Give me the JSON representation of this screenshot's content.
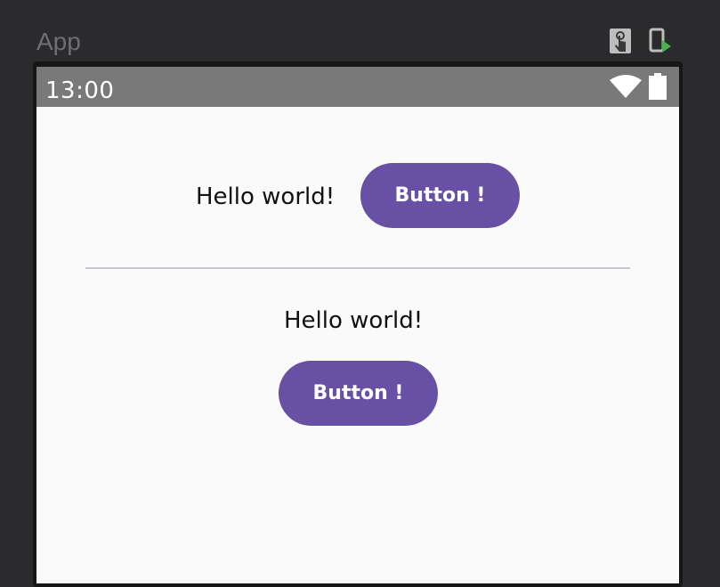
{
  "preview": {
    "title": "App",
    "touch_icon": "touch-mode-icon",
    "deploy_icon": "deploy-to-device-icon",
    "deploy_color": "#4caf50"
  },
  "status_bar": {
    "time": "13:00",
    "background": "#797979",
    "icons": [
      "wifi-icon",
      "battery-icon"
    ]
  },
  "content": {
    "row": {
      "text": "Hello world!",
      "button_label": "Button !"
    },
    "column": {
      "text": "Hello world!",
      "button_label": "Button !"
    },
    "accent_color": "#6850a4",
    "divider_color": "#c9c6cf"
  }
}
